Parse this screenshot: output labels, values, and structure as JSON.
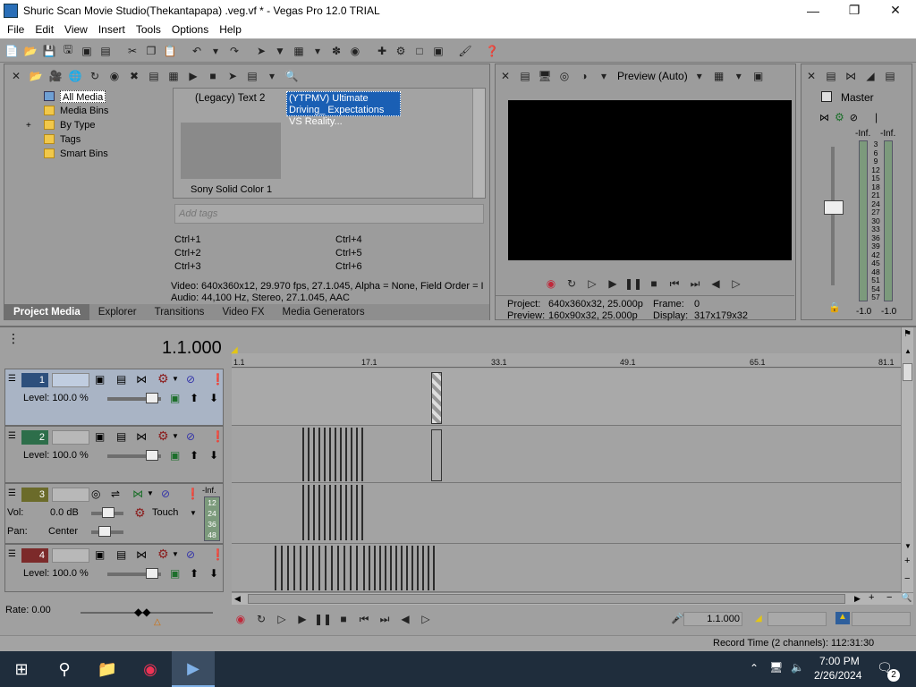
{
  "window": {
    "title": "Shuric Scan Movie Studio(Thekantapapa) .veg.vf * - Vegas Pro 12.0 TRIAL"
  },
  "menu": [
    "File",
    "Edit",
    "View",
    "Insert",
    "Tools",
    "Options",
    "Help"
  ],
  "media_tree": [
    "All Media",
    "Media Bins",
    "By Type",
    "Tags",
    "Smart Bins"
  ],
  "media_items": {
    "legacy_text": "(Legacy) Text 2",
    "ytpmv": "(YTPMV) Ultimate Driving_ Expectations VS Reality...",
    "solid": "Sony Solid Color 1"
  },
  "tags": {
    "placeholder": "Add tags",
    "shortcuts": [
      "Ctrl+1",
      "Ctrl+4",
      "Ctrl+2",
      "Ctrl+5",
      "Ctrl+3",
      "Ctrl+6"
    ]
  },
  "media_info": {
    "video": "Video: 640x360x12, 29.970 fps, 27.1.045, Alpha = None, Field Order = I",
    "audio": "Audio: 44,100 Hz, Stereo, 27.1.045, AAC"
  },
  "left_tabs": [
    "Project Media",
    "Explorer",
    "Transitions",
    "Video FX",
    "Media Generators"
  ],
  "preview": {
    "mode": "Preview (Auto)",
    "project_label": "Project:",
    "project_value": "640x360x32, 25.000p",
    "frame_label": "Frame:",
    "frame_value": "0",
    "preview_label": "Preview:",
    "preview_value": "160x90x32, 25.000p",
    "display_label": "Display:",
    "display_value": "317x179x32"
  },
  "master": {
    "label": "Master",
    "inf_left": "-Inf.",
    "inf_right": "-Inf.",
    "bottom_left": "-1.0",
    "bottom_right": "-1.0",
    "scale": [
      "3",
      "6",
      "9",
      "12",
      "15",
      "18",
      "21",
      "24",
      "27",
      "30",
      "33",
      "36",
      "39",
      "42",
      "45",
      "48",
      "51",
      "54",
      "57"
    ]
  },
  "timeline": {
    "timecode": "1.1.000",
    "ruler": [
      "1.1",
      "17.1",
      "33.1",
      "49.1",
      "65.1",
      "81.1"
    ],
    "rate": "Rate: 0.00",
    "cursor_time": "1.1.000",
    "record_time": "Record Time (2 channels): 112:31:30"
  },
  "tracks": [
    {
      "num": "1",
      "level": "Level: 100.0 %"
    },
    {
      "num": "2",
      "level": "Level: 100.0 %"
    },
    {
      "num": "3",
      "vol_label": "Vol:",
      "vol": "0.0 dB",
      "pan_label": "Pan:",
      "pan": "Center",
      "mode": "Touch",
      "inf": "-Inf.",
      "meter": [
        "12",
        "24",
        "36",
        "48"
      ]
    },
    {
      "num": "4",
      "level": "Level: 100.0 %"
    }
  ],
  "taskbar": {
    "time": "7:00 PM",
    "date": "2/26/2024",
    "notif": "2"
  },
  "colors": {
    "track1": "#2d4f7c",
    "track2": "#2d6e4a",
    "track3": "#6b6b2a",
    "track4": "#7c2a2a",
    "ytpmv_highlight": "#1a5fb4"
  }
}
